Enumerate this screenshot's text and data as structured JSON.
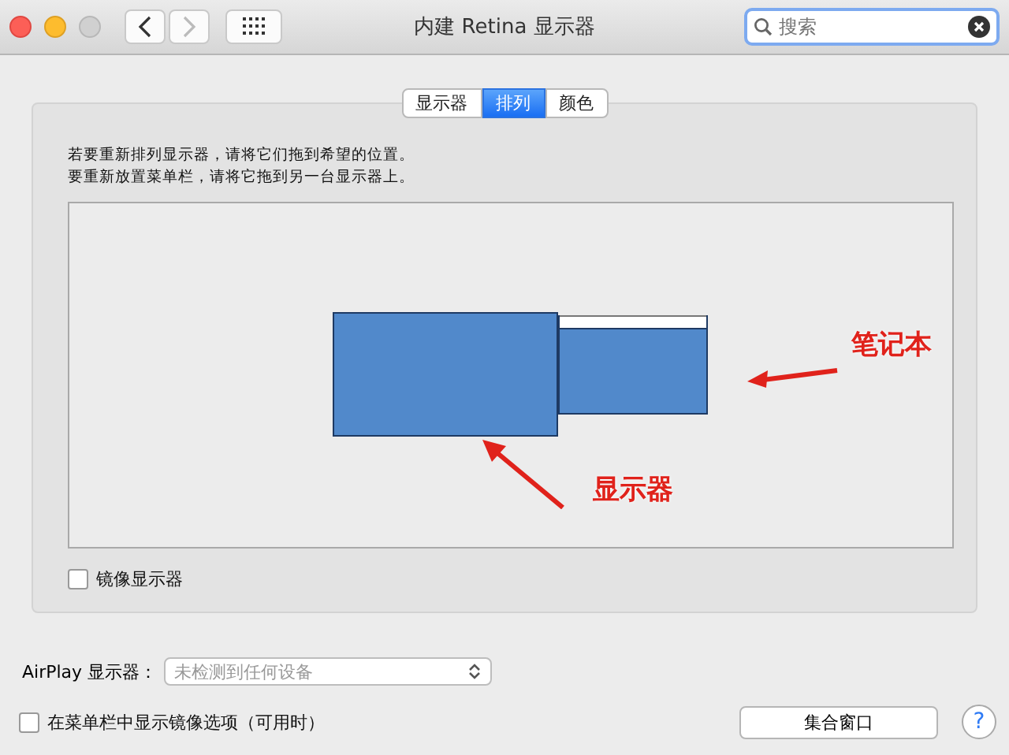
{
  "window": {
    "title": "内建 Retina 显示器"
  },
  "search": {
    "placeholder": "搜索"
  },
  "tabs": [
    {
      "label": "显示器",
      "selected": false
    },
    {
      "label": "排列",
      "selected": true
    },
    {
      "label": "颜色",
      "selected": false
    }
  ],
  "instructions": [
    "若要重新排列显示器，请将它们拖到希望的位置。",
    "要重新放置菜单栏，请将它拖到另一台显示器上。"
  ],
  "annotations": [
    {
      "label": "笔记本"
    },
    {
      "label": "显示器"
    }
  ],
  "mirror": {
    "label": "镜像显示器",
    "checked": false
  },
  "airplay": {
    "label": "AirPlay 显示器：",
    "value": "未检测到任何设备",
    "disabled": true
  },
  "menu_option": {
    "label": "在菜单栏中显示镜像选项（可用时）",
    "checked": false
  },
  "gather_button": "集合窗口",
  "help": "?"
}
